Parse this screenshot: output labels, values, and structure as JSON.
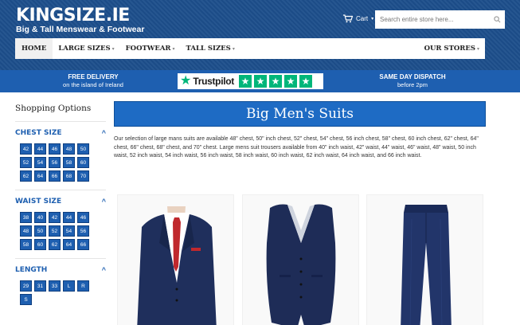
{
  "header": {
    "logo_main_bold": "KING",
    "logo_main_rest": "SIZE.IE",
    "logo_sub": "Big & Tall Menswear & Footwear",
    "cart_label": "Cart",
    "search_placeholder": "Search entire store here..."
  },
  "nav": {
    "items": [
      {
        "label": "HOME"
      },
      {
        "label": "LARGE SIZES"
      },
      {
        "label": "FOOTWEAR"
      },
      {
        "label": "TALL SIZES"
      }
    ],
    "right_label": "OUR STORES"
  },
  "promo": {
    "delivery_title": "FREE DELIVERY",
    "delivery_sub": "on the island of Ireland",
    "trustpilot_label": "Trustpilot",
    "dispatch_title": "SAME DAY DISPATCH",
    "dispatch_sub": "before 2pm"
  },
  "sidebar": {
    "title": "Shopping Options",
    "chest": {
      "label": "CHEST SIZE",
      "sizes": [
        "42",
        "44",
        "46",
        "48",
        "50",
        "52",
        "54",
        "56",
        "58",
        "60",
        "62",
        "64",
        "66",
        "68",
        "70"
      ]
    },
    "waist": {
      "label": "WAIST SIZE",
      "sizes": [
        "38",
        "40",
        "42",
        "44",
        "46",
        "48",
        "50",
        "52",
        "54",
        "56",
        "58",
        "60",
        "62",
        "64",
        "66"
      ]
    },
    "length": {
      "label": "LENGTH",
      "sizes": [
        "29",
        "31",
        "33",
        "L",
        "R",
        "S"
      ]
    }
  },
  "main": {
    "title": "Big Men's Suits",
    "intro": "Our selection of large mans suits are available 48\" chest, 50\" inch chest, 52\" chest, 54\" chest, 56 inch chest, 58\" chest, 60 inch chest, 62\" chest, 64\" chest, 66\" chest, 68\" chest, and 70\" chest. Large mens suit trousers available from 40\" inch waist, 42\" waist, 44\" waist, 46\" waist, 48\" waist, 50 inch waist, 52 inch waist, 54 inch waist, 56 inch waist, 58 inch waist, 60 inch waist, 62 inch waist, 64 inch waist, and 66 inch waist."
  },
  "colors": {
    "brand_dark": "#1d4f8c",
    "brand_blue": "#1e5fb0",
    "trustpilot_green": "#00b67a",
    "suit_navy": "#1f2f5c",
    "tie_red": "#c0282d"
  }
}
